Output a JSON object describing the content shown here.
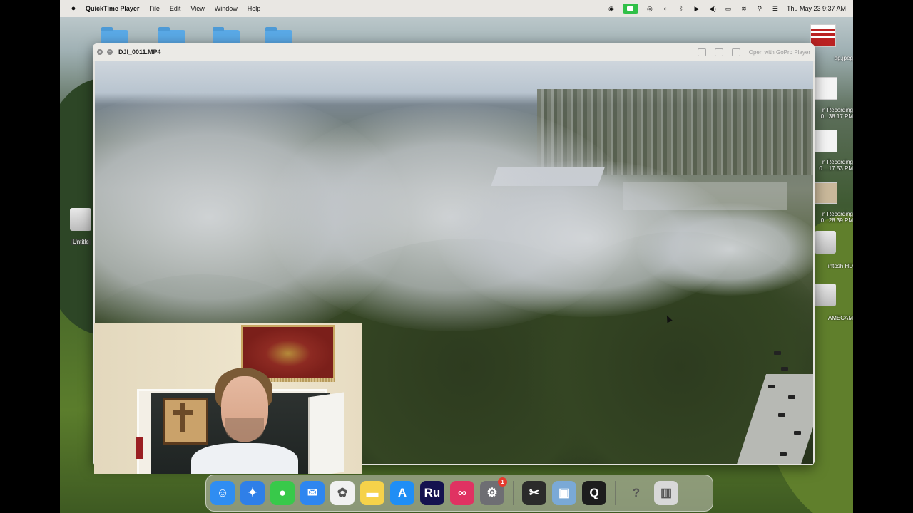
{
  "menubar": {
    "app_name": "QuickTime Player",
    "items": [
      "File",
      "Edit",
      "View",
      "Window",
      "Help"
    ],
    "datetime": "Thu May 23  9:37 AM"
  },
  "window": {
    "title": "DJI_0011.MP4",
    "open_with_label": "Open with GoPro Player"
  },
  "desktop": {
    "items": [
      {
        "label": "ag.jpeg"
      },
      {
        "label": "n Recording\n0...38.17 PM"
      },
      {
        "label": "n Recording\n0....17.53 PM"
      },
      {
        "label": "n Recording\n0...28.39 PM"
      },
      {
        "label": "intosh HD"
      },
      {
        "label": "AMECAM"
      }
    ],
    "left_item": "Untitle"
  },
  "dock": {
    "items": [
      {
        "name": "finder-icon",
        "glyph": "☺",
        "color": "#2f8df2"
      },
      {
        "name": "safari-icon",
        "glyph": "✦",
        "color": "#2f7fe8"
      },
      {
        "name": "messages-icon",
        "glyph": "●",
        "color": "#38c94a"
      },
      {
        "name": "mail-icon",
        "glyph": "✉",
        "color": "#2e86f0"
      },
      {
        "name": "photos-icon",
        "glyph": "✿",
        "color": "#f1f1f1"
      },
      {
        "name": "notes-icon",
        "glyph": "▬",
        "color": "#f6d24a"
      },
      {
        "name": "app-store-icon",
        "glyph": "A",
        "color": "#1f8ef5"
      },
      {
        "name": "premiere-rush-icon",
        "glyph": "Ru",
        "color": "#14124f"
      },
      {
        "name": "creative-cloud-icon",
        "glyph": "∞",
        "color": "#e03262"
      },
      {
        "name": "system-settings-icon",
        "glyph": "⚙",
        "color": "#6e6e73",
        "badge": "1"
      },
      {
        "name": "capcut-icon",
        "glyph": "✂",
        "color": "#2b2b2b"
      },
      {
        "name": "preview-icon",
        "glyph": "▣",
        "color": "#7aa9d6"
      },
      {
        "name": "quicktime-icon",
        "glyph": "Q",
        "color": "#1d1d1d"
      },
      {
        "name": "help-icon",
        "glyph": "?",
        "color": "#9a9a9a"
      },
      {
        "name": "trash-icon",
        "glyph": "▥",
        "color": "#d8d8d8"
      }
    ]
  }
}
